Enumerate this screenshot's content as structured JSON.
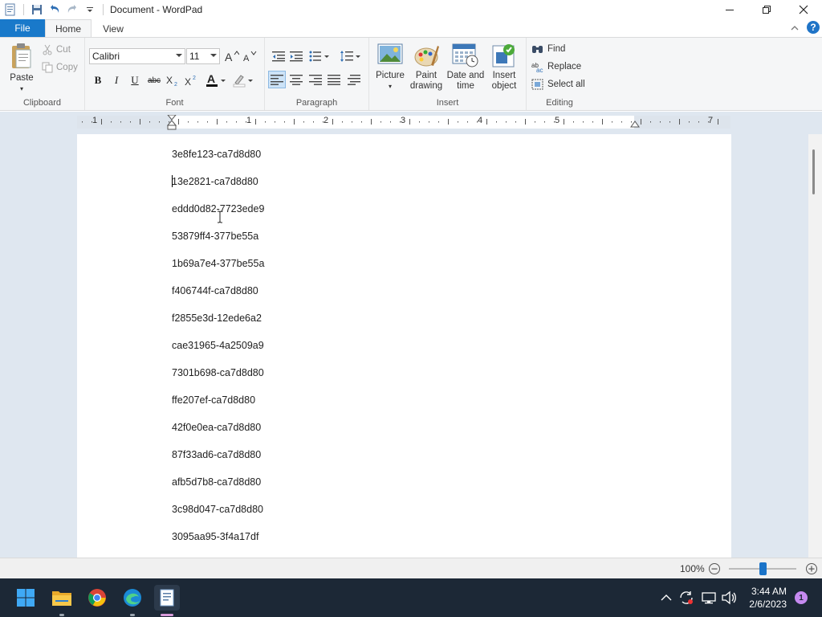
{
  "window": {
    "title": "Document - WordPad"
  },
  "tabs": {
    "file": "File",
    "home": "Home",
    "view": "View"
  },
  "clipboard": {
    "group": "Clipboard",
    "paste": "Paste",
    "cut": "Cut",
    "copy": "Copy"
  },
  "font": {
    "group": "Font",
    "family": "Calibri",
    "size": "11"
  },
  "paragraph": {
    "group": "Paragraph"
  },
  "insert": {
    "group": "Insert",
    "picture": "Picture",
    "paint_line1": "Paint",
    "paint_line2": "drawing",
    "datetime_line1": "Date and",
    "datetime_line2": "time",
    "object_line1": "Insert",
    "object_line2": "object"
  },
  "editing": {
    "group": "Editing",
    "find": "Find",
    "replace": "Replace",
    "select_all": "Select all"
  },
  "ruler": {
    "labels": [
      "1",
      "1",
      "2",
      "3",
      "4",
      "5",
      "7"
    ]
  },
  "document": {
    "lines": [
      "3e8fe123-ca7d8d80",
      "13e2821-ca7d8d80",
      "eddd0d82-7723ede9",
      "53879ff4-377be55a",
      "1b69a7e4-377be55a",
      "f406744f-ca7d8d80",
      "f2855e3d-12ede6a2",
      "cae31965-4a2509a9",
      "7301b698-ca7d8d80",
      "ffe207ef-ca7d8d80",
      "42f0e0ea-ca7d8d80",
      "87f33ad6-ca7d8d80",
      "afb5d7b8-ca7d8d80",
      "3c98d047-ca7d8d80",
      "3095aa95-3f4a17df"
    ]
  },
  "status": {
    "zoom": "100%"
  },
  "taskbar": {
    "time": "3:44 AM",
    "date": "2/6/2023",
    "notifications": "1"
  },
  "colors": {
    "accent": "#1979ca",
    "taskbar": "#1c2836"
  }
}
